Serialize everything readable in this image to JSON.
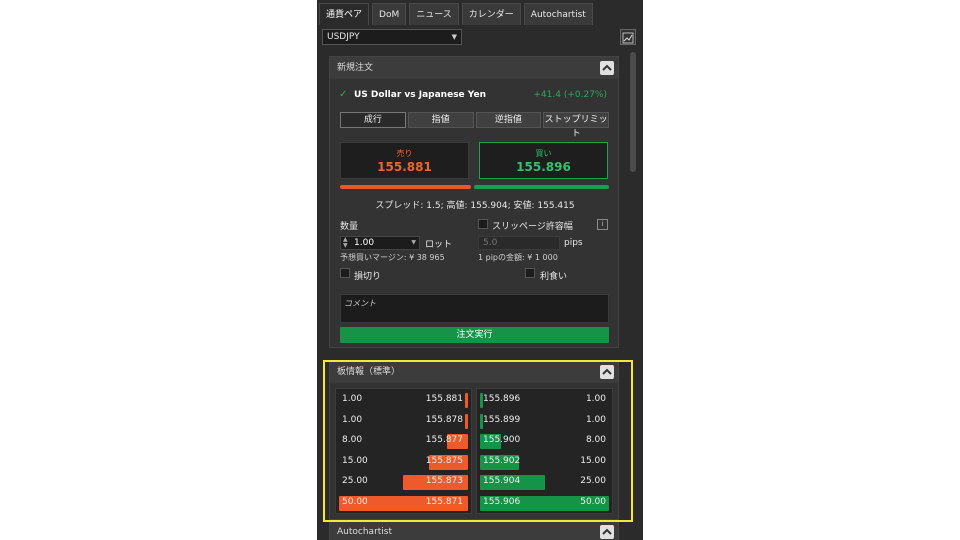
{
  "tabs": [
    "通貨ペア",
    "DoM",
    "ニュース",
    "カレンダー",
    "Autochartist"
  ],
  "active_tab": 0,
  "symbol": {
    "selected": "USDJPY"
  },
  "order_panel": {
    "title": "新規注文",
    "instrument": "US Dollar vs Japanese Yen",
    "change": "+41.4 (+0.27%)",
    "order_types": [
      "成行",
      "指値",
      "逆指値",
      "ストップリミット"
    ],
    "sell_label": "売り",
    "sell_price": "155.881",
    "buy_label": "買い",
    "buy_price": "155.896",
    "spread_text": "スプレッド: 1.5; 高値: 155.904; 安値: 155.415",
    "quantity_label": "数量",
    "quantity_value": "1.00",
    "lot_label": "ロット",
    "margin_text": "予想買いマージン: ¥ 38 965",
    "slippage_label": "スリッページ許容幅",
    "slippage_value": "5.0",
    "pips_label": "pips",
    "pip_value_text": "1 pipの金額: ¥ 1 000",
    "stop_loss_label": "損切り",
    "take_profit_label": "利食い",
    "comment_placeholder": "コメント",
    "submit_label": "注文実行"
  },
  "dom_panel": {
    "title": "板情報（標準）",
    "bids": [
      {
        "volume": "1.00",
        "price": "155.881",
        "level": 0.02
      },
      {
        "volume": "1.00",
        "price": "155.878",
        "level": 0.02
      },
      {
        "volume": "8.00",
        "price": "155.877",
        "level": 0.16
      },
      {
        "volume": "15.00",
        "price": "155.875",
        "level": 0.3
      },
      {
        "volume": "25.00",
        "price": "155.873",
        "level": 0.5
      },
      {
        "volume": "50.00",
        "price": "155.871",
        "level": 1.0
      }
    ],
    "asks": [
      {
        "price": "155.896",
        "volume": "1.00",
        "level": 0.02
      },
      {
        "price": "155.899",
        "volume": "1.00",
        "level": 0.02
      },
      {
        "price": "155.900",
        "volume": "8.00",
        "level": 0.16
      },
      {
        "price": "155.902",
        "volume": "15.00",
        "level": 0.3
      },
      {
        "price": "155.904",
        "volume": "25.00",
        "level": 0.5
      },
      {
        "price": "155.906",
        "volume": "50.00",
        "level": 1.0
      }
    ]
  },
  "autochartist_panel": {
    "title": "Autochartist"
  },
  "colors": {
    "sell": "#ef5a2a",
    "buy": "#159447",
    "highlight": "#f2ea2e"
  }
}
